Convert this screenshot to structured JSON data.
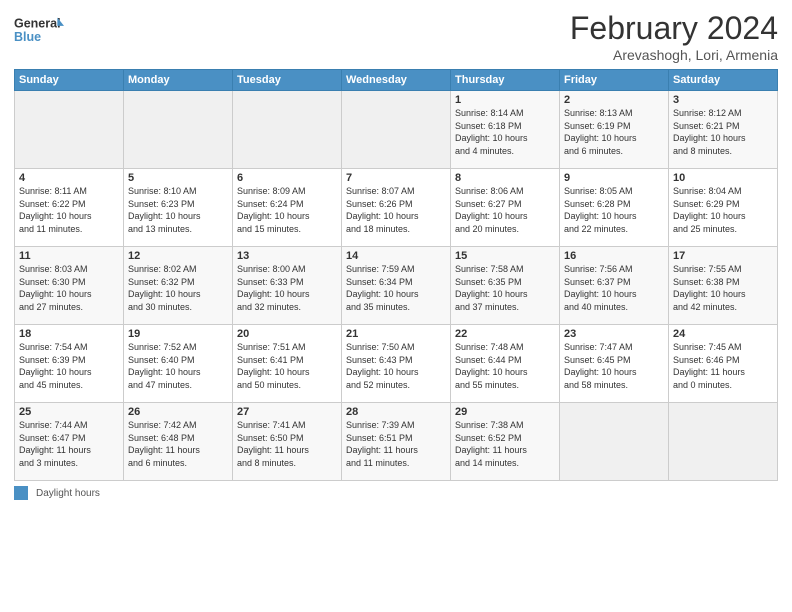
{
  "header": {
    "logo_line1": "General",
    "logo_line2": "Blue",
    "month": "February 2024",
    "location": "Arevashogh, Lori, Armenia"
  },
  "days_of_week": [
    "Sunday",
    "Monday",
    "Tuesday",
    "Wednesday",
    "Thursday",
    "Friday",
    "Saturday"
  ],
  "weeks": [
    [
      {
        "day": "",
        "info": ""
      },
      {
        "day": "",
        "info": ""
      },
      {
        "day": "",
        "info": ""
      },
      {
        "day": "",
        "info": ""
      },
      {
        "day": "1",
        "info": "Sunrise: 8:14 AM\nSunset: 6:18 PM\nDaylight: 10 hours\nand 4 minutes."
      },
      {
        "day": "2",
        "info": "Sunrise: 8:13 AM\nSunset: 6:19 PM\nDaylight: 10 hours\nand 6 minutes."
      },
      {
        "day": "3",
        "info": "Sunrise: 8:12 AM\nSunset: 6:21 PM\nDaylight: 10 hours\nand 8 minutes."
      }
    ],
    [
      {
        "day": "4",
        "info": "Sunrise: 8:11 AM\nSunset: 6:22 PM\nDaylight: 10 hours\nand 11 minutes."
      },
      {
        "day": "5",
        "info": "Sunrise: 8:10 AM\nSunset: 6:23 PM\nDaylight: 10 hours\nand 13 minutes."
      },
      {
        "day": "6",
        "info": "Sunrise: 8:09 AM\nSunset: 6:24 PM\nDaylight: 10 hours\nand 15 minutes."
      },
      {
        "day": "7",
        "info": "Sunrise: 8:07 AM\nSunset: 6:26 PM\nDaylight: 10 hours\nand 18 minutes."
      },
      {
        "day": "8",
        "info": "Sunrise: 8:06 AM\nSunset: 6:27 PM\nDaylight: 10 hours\nand 20 minutes."
      },
      {
        "day": "9",
        "info": "Sunrise: 8:05 AM\nSunset: 6:28 PM\nDaylight: 10 hours\nand 22 minutes."
      },
      {
        "day": "10",
        "info": "Sunrise: 8:04 AM\nSunset: 6:29 PM\nDaylight: 10 hours\nand 25 minutes."
      }
    ],
    [
      {
        "day": "11",
        "info": "Sunrise: 8:03 AM\nSunset: 6:30 PM\nDaylight: 10 hours\nand 27 minutes."
      },
      {
        "day": "12",
        "info": "Sunrise: 8:02 AM\nSunset: 6:32 PM\nDaylight: 10 hours\nand 30 minutes."
      },
      {
        "day": "13",
        "info": "Sunrise: 8:00 AM\nSunset: 6:33 PM\nDaylight: 10 hours\nand 32 minutes."
      },
      {
        "day": "14",
        "info": "Sunrise: 7:59 AM\nSunset: 6:34 PM\nDaylight: 10 hours\nand 35 minutes."
      },
      {
        "day": "15",
        "info": "Sunrise: 7:58 AM\nSunset: 6:35 PM\nDaylight: 10 hours\nand 37 minutes."
      },
      {
        "day": "16",
        "info": "Sunrise: 7:56 AM\nSunset: 6:37 PM\nDaylight: 10 hours\nand 40 minutes."
      },
      {
        "day": "17",
        "info": "Sunrise: 7:55 AM\nSunset: 6:38 PM\nDaylight: 10 hours\nand 42 minutes."
      }
    ],
    [
      {
        "day": "18",
        "info": "Sunrise: 7:54 AM\nSunset: 6:39 PM\nDaylight: 10 hours\nand 45 minutes."
      },
      {
        "day": "19",
        "info": "Sunrise: 7:52 AM\nSunset: 6:40 PM\nDaylight: 10 hours\nand 47 minutes."
      },
      {
        "day": "20",
        "info": "Sunrise: 7:51 AM\nSunset: 6:41 PM\nDaylight: 10 hours\nand 50 minutes."
      },
      {
        "day": "21",
        "info": "Sunrise: 7:50 AM\nSunset: 6:43 PM\nDaylight: 10 hours\nand 52 minutes."
      },
      {
        "day": "22",
        "info": "Sunrise: 7:48 AM\nSunset: 6:44 PM\nDaylight: 10 hours\nand 55 minutes."
      },
      {
        "day": "23",
        "info": "Sunrise: 7:47 AM\nSunset: 6:45 PM\nDaylight: 10 hours\nand 58 minutes."
      },
      {
        "day": "24",
        "info": "Sunrise: 7:45 AM\nSunset: 6:46 PM\nDaylight: 11 hours\nand 0 minutes."
      }
    ],
    [
      {
        "day": "25",
        "info": "Sunrise: 7:44 AM\nSunset: 6:47 PM\nDaylight: 11 hours\nand 3 minutes."
      },
      {
        "day": "26",
        "info": "Sunrise: 7:42 AM\nSunset: 6:48 PM\nDaylight: 11 hours\nand 6 minutes."
      },
      {
        "day": "27",
        "info": "Sunrise: 7:41 AM\nSunset: 6:50 PM\nDaylight: 11 hours\nand 8 minutes."
      },
      {
        "day": "28",
        "info": "Sunrise: 7:39 AM\nSunset: 6:51 PM\nDaylight: 11 hours\nand 11 minutes."
      },
      {
        "day": "29",
        "info": "Sunrise: 7:38 AM\nSunset: 6:52 PM\nDaylight: 11 hours\nand 14 minutes."
      },
      {
        "day": "",
        "info": ""
      },
      {
        "day": "",
        "info": ""
      }
    ]
  ],
  "footer": {
    "legend_label": "Daylight hours"
  }
}
